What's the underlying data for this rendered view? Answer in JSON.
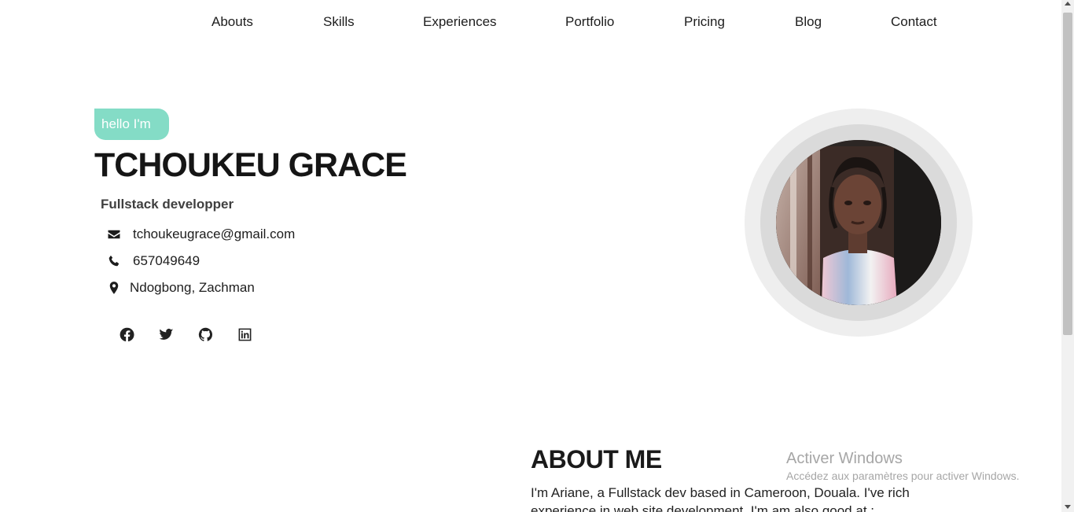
{
  "nav": {
    "items": [
      {
        "label": "Abouts"
      },
      {
        "label": "Skills"
      },
      {
        "label": "Experiences"
      },
      {
        "label": "Portfolio"
      },
      {
        "label": "Pricing"
      },
      {
        "label": "Blog"
      },
      {
        "label": "Contact"
      }
    ]
  },
  "hero": {
    "badge": "hello I'm",
    "name": "TCHOUKEU GRACE",
    "role": "Fullstack developper",
    "email": {
      "icon": "envelope-icon",
      "text": "tchoukeugrace@gmail.com"
    },
    "phone": {
      "icon": "phone-icon",
      "text": "657049649"
    },
    "location": {
      "icon": "map-marker-icon",
      "text": "Ndogbong, Zachman"
    },
    "socials": [
      "facebook-icon",
      "twitter-icon",
      "github-icon",
      "linkedin-icon"
    ]
  },
  "about": {
    "title": "ABOUT ME",
    "text": "I'm Ariane, a Fullstack dev based in Cameroon, Douala. I've rich experience in web site development. I'm am also good at :"
  },
  "watermark": {
    "title": "Activer Windows",
    "subtitle": "Accédez aux paramètres pour activer Windows."
  },
  "colors": {
    "accent": "#84dcc6",
    "text": "#1a1a1a",
    "avatar_ring_outer": "#eeeeee",
    "avatar_ring_inner": "#dadada"
  }
}
